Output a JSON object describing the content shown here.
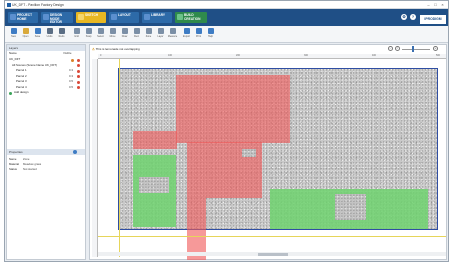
{
  "window": {
    "title": "UK_DFT - Pavilion Factory Design"
  },
  "ribbon": {
    "tabs": [
      {
        "line1": "PROJECT",
        "line2": "HOME"
      },
      {
        "line1": "DESIGN",
        "line2": "MODE EDITOR"
      },
      {
        "line1": "SKETCH",
        "line2": ""
      },
      {
        "line1": "LAYOUT",
        "line2": ""
      },
      {
        "line1": "LIBRARY",
        "line2": ""
      },
      {
        "line1": "BUILD",
        "line2": "CREATION"
      }
    ],
    "brand": "IPRODIGM"
  },
  "toolbar": {
    "buttons": [
      "New",
      "Open",
      "Save",
      "Undo",
      "Redo",
      "Grid",
      "Snap",
      "Select",
      "Move",
      "Draw",
      "Rect",
      "Zone",
      "Layer",
      "Measure",
      "Export",
      "Print",
      "Help"
    ]
  },
  "sidebar": {
    "tree_header": "Layers",
    "col_name": "Name",
    "col_value": "Visible",
    "items": [
      {
        "name": "UK_DFT",
        "value": "",
        "indent": 1
      },
      {
        "name": "All Scenes (Scene Name UK_DFT)",
        "value": "",
        "indent": 2
      },
      {
        "name": "Parcel 1",
        "value": "0.3",
        "indent": 3
      },
      {
        "name": "Parcel 2",
        "value": "0.3",
        "indent": 3
      },
      {
        "name": "Parcel 3",
        "value": "0.5",
        "indent": 3
      },
      {
        "name": "Parcel 4",
        "value": "0.5",
        "indent": 3
      },
      {
        "name": "Add design",
        "value": "",
        "indent": 1
      }
    ],
    "props_header": "Properties",
    "props": [
      {
        "k": "Name",
        "v": "Zone"
      },
      {
        "k": "Material",
        "v": "Meadow grass"
      },
      {
        "k": "Status",
        "v": "Not started"
      }
    ]
  },
  "canvas": {
    "warning": "This is lemonade not overlapping",
    "zoom_out": "−",
    "zoom_in": "+",
    "ruler_marks": [
      "0",
      "100",
      "200",
      "300",
      "400",
      "500"
    ]
  },
  "colors": {
    "ribbon": "#1f4f86",
    "active_tab": "#e7b722",
    "red_zone": "#f05a5a",
    "green_zone": "#6ed26e"
  }
}
